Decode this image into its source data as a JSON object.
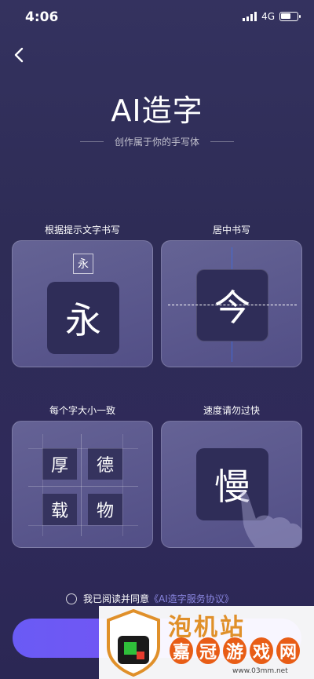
{
  "status": {
    "time": "4:06",
    "network": "4G"
  },
  "header": {
    "title": "AI造字",
    "subtitle": "创作属于你的手写体"
  },
  "cards": [
    {
      "label": "根据提示文字书写",
      "hint_char": "永",
      "char": "永"
    },
    {
      "label": "居中书写",
      "char": "今"
    },
    {
      "label": "每个字大小一致",
      "chars": [
        "厚",
        "德",
        "载",
        "物"
      ]
    },
    {
      "label": "速度请勿过快",
      "char": "慢"
    }
  ],
  "agreement": {
    "prefix": "我已阅读并同意",
    "link": "《AI造字服务协议》"
  },
  "watermark": {
    "title": "泡机站",
    "chars": [
      "嘉",
      "冠",
      "游",
      "戏",
      "网"
    ],
    "url": "www.03mm.net"
  },
  "icons": {
    "back": "chevron-left-icon",
    "wifi_signal": "signal-icon",
    "battery": "battery-icon"
  }
}
